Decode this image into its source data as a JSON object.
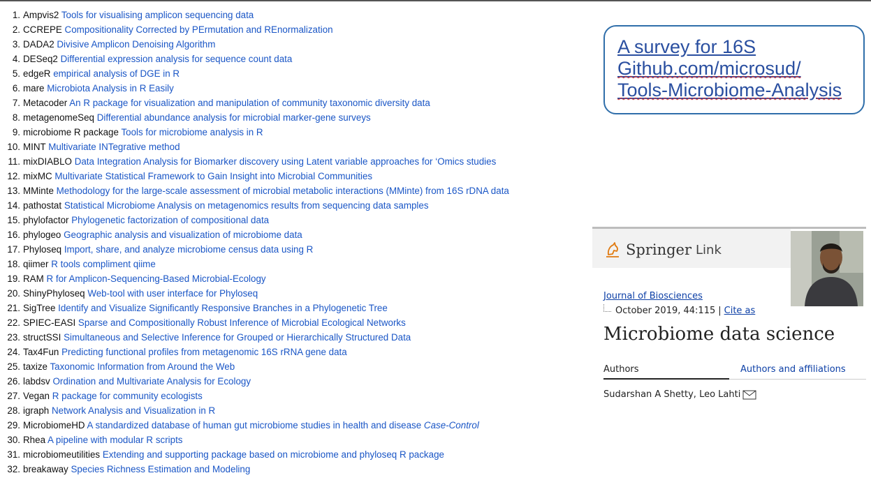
{
  "tools": [
    {
      "num": "1.",
      "name": "Ampvis2",
      "desc": "Tools for visualising amplicon sequencing data"
    },
    {
      "num": "2.",
      "name": "CCREPE",
      "desc": "Compositionality Corrected by PErmutation and REnormalization"
    },
    {
      "num": "3.",
      "name": "DADA2",
      "desc": "Divisive Amplicon Denoising Algorithm"
    },
    {
      "num": "4.",
      "name": "DESeq2",
      "desc": "Differential expression analysis for sequence count data"
    },
    {
      "num": "5.",
      "name": "edgeR",
      "desc": "empirical analysis of DGE in R"
    },
    {
      "num": "6.",
      "name": "mare",
      "desc": "Microbiota Analysis in R Easily"
    },
    {
      "num": "7.",
      "name": "Metacoder",
      "desc": "An R package for visualization and manipulation of community taxonomic diversity data"
    },
    {
      "num": "8.",
      "name": "metagenomeSeq",
      "desc": "Differential abundance analysis for microbial marker-gene surveys"
    },
    {
      "num": "9.",
      "name": "microbiome R package",
      "desc": "Tools for microbiome analysis in R"
    },
    {
      "num": "10.",
      "name": "MINT",
      "desc": "Multivariate INTegrative method"
    },
    {
      "num": "11.",
      "name": "mixDIABLO",
      "desc": "Data Integration Analysis for Biomarker discovery using Latent variable approaches for ‘Omics studies"
    },
    {
      "num": "12.",
      "name": "mixMC",
      "desc": "Multivariate Statistical Framework to Gain Insight into Microbial Communities"
    },
    {
      "num": "13.",
      "name": "MMinte",
      "desc": "Methodology for the large-scale assessment of microbial metabolic interactions (MMinte) from 16S rDNA data"
    },
    {
      "num": "14.",
      "name": "pathostat",
      "desc": "Statistical Microbiome Analysis on metagenomics results from sequencing data samples"
    },
    {
      "num": "15.",
      "name": "phylofactor",
      "desc": "Phylogenetic factorization of compositional data"
    },
    {
      "num": "16.",
      "name": "phylogeo",
      "desc": "Geographic analysis and visualization of microbiome data"
    },
    {
      "num": "17.",
      "name": "Phyloseq",
      "desc": "Import, share, and analyze microbiome census data using R"
    },
    {
      "num": "18.",
      "name": "qiimer",
      "desc": "R tools compliment qiime"
    },
    {
      "num": "19.",
      "name": "RAM",
      "desc": "R for Amplicon-Sequencing-Based Microbial-Ecology"
    },
    {
      "num": "20.",
      "name": "ShinyPhyloseq",
      "desc": "Web-tool with user interface for Phyloseq"
    },
    {
      "num": "21.",
      "name": "SigTree",
      "desc": "Identify and Visualize Significantly Responsive Branches in a Phylogenetic Tree"
    },
    {
      "num": "22.",
      "name": "SPIEC-EASI",
      "desc": "Sparse and Compositionally Robust Inference of Microbial Ecological Networks"
    },
    {
      "num": "23.",
      "name": "structSSI",
      "desc": "Simultaneous and Selective Inference for Grouped or Hierarchically Structured Data"
    },
    {
      "num": "24.",
      "name": "Tax4Fun",
      "desc": "Predicting functional profiles from metagenomic 16S rRNA gene data"
    },
    {
      "num": "25.",
      "name": "taxize",
      "desc": "Taxonomic Information from Around the Web"
    },
    {
      "num": "26.",
      "name": "labdsv",
      "desc": "Ordination and Multivariate Analysis for Ecology"
    },
    {
      "num": "27.",
      "name": "Vegan",
      "desc": "R package for community ecologists"
    },
    {
      "num": "28.",
      "name": "igraph",
      "desc": "Network Analysis and Visualization in R"
    },
    {
      "num": "29.",
      "name": "MicrobiomeHD",
      "desc": "A standardized database of human gut microbiome studies in health and disease",
      "extra": "Case-Control"
    },
    {
      "num": "30.",
      "name": "Rhea",
      "desc": "A pipeline with modular R scripts"
    },
    {
      "num": "31.",
      "name": "microbiomeutilities",
      "desc": "Extending and supporting package based on microbiome and phyloseq R package"
    },
    {
      "num": "32.",
      "name": "breakaway",
      "desc": "Species Richness Estimation and Modeling"
    }
  ],
  "survey": {
    "line1": "A survey for 16S",
    "line2": "Github.com/microsud/",
    "line3": "Tools-Microbiome-Analysis"
  },
  "springer": {
    "brand": "Springer",
    "brand_suffix": "Link",
    "journal": "Journal of Biosciences",
    "pub_date": "October 2019, 44:115",
    "separator": "|",
    "cite_label": "Cite as",
    "title": "Microbiome data science",
    "authors_tab": "Authors",
    "affiliations_tab": "Authors and affiliations",
    "author_names": "Sudarshan A Shetty, Leo Lahti"
  },
  "colors": {
    "link_blue": "#1a56c6",
    "survey_border": "#2f6eaa",
    "springer_link": "#0c3fa6"
  }
}
